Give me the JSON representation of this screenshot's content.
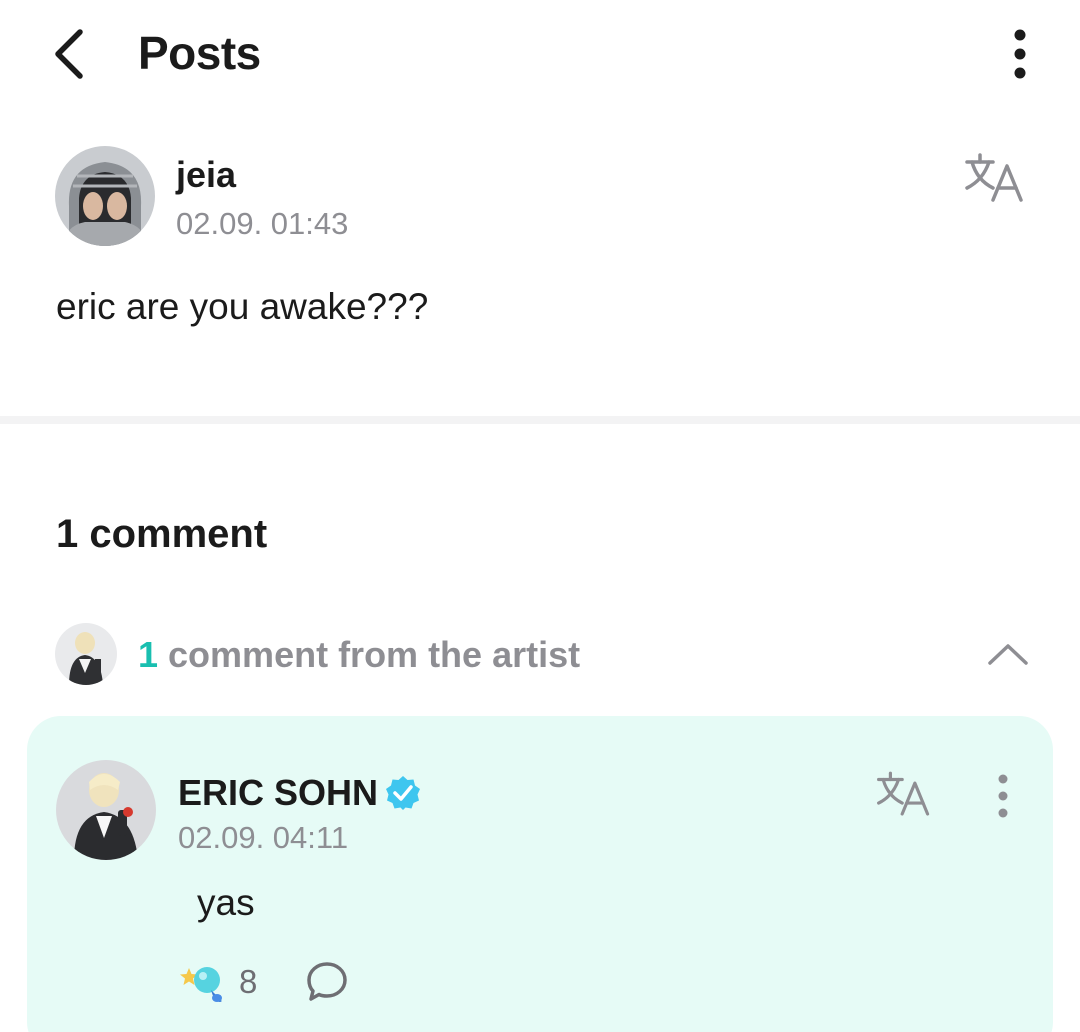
{
  "header": {
    "title": "Posts"
  },
  "post": {
    "author": "jeia",
    "time": "02.09. 01:43",
    "body": "eric are you awake???"
  },
  "comments": {
    "count_label": "1 comment",
    "artist_section": {
      "count": "1",
      "label": " comment from the artist"
    },
    "items": [
      {
        "author": "ERIC SOHN",
        "time": "02.09. 04:11",
        "body": "yas",
        "reactions": "8"
      }
    ]
  },
  "colors": {
    "accent": "#19bfb0",
    "card_background": "#e6fbf6",
    "verified": "#3ec6ef"
  },
  "icons": [
    "back-arrow-icon",
    "more-vertical-icon",
    "translate-icon",
    "chevron-up-icon",
    "verified-badge-icon",
    "reaction-icon",
    "reply-bubble-icon"
  ]
}
